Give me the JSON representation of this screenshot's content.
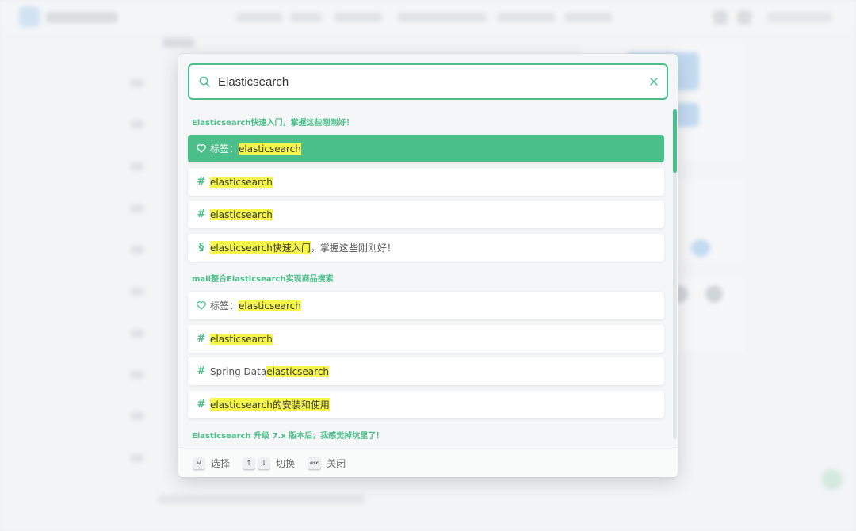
{
  "search": {
    "value": "Elasticsearch"
  },
  "groups": [
    {
      "title": "Elasticsearch快速入门，掌握这些刚刚好！",
      "hits": [
        {
          "icon": "heart-icon",
          "prefix": "标签：",
          "match": "elasticsearch",
          "suffix": "",
          "active": true
        },
        {
          "icon": "hash-icon",
          "prefix": "",
          "match": "elasticsearch",
          "suffix": "",
          "active": false
        },
        {
          "icon": "hash-icon",
          "prefix": "",
          "match": "elasticsearch",
          "suffix": "",
          "active": false
        },
        {
          "icon": "section-icon",
          "prefix": "",
          "match": "elasticsearch快速入门",
          "suffix": "，掌握这些刚刚好！",
          "active": false
        }
      ]
    },
    {
      "title": "mall整合Elasticsearch实现商品搜索",
      "hits": [
        {
          "icon": "heart-icon",
          "prefix": "标签：",
          "match": "elasticsearch",
          "suffix": "",
          "active": false
        },
        {
          "icon": "hash-icon",
          "prefix": "",
          "match": "elasticsearch",
          "suffix": "",
          "active": false
        },
        {
          "icon": "hash-icon",
          "prefix": "Spring Data ",
          "match": "elasticsearch",
          "suffix": "",
          "active": false
        },
        {
          "icon": "hash-icon",
          "prefix": "",
          "match": "elasticsearch的安装和使用",
          "suffix": "",
          "active": false
        }
      ]
    },
    {
      "title": "Elasticsearch 升级 7.x 版本后，我感觉掉坑里了！",
      "hits": []
    }
  ],
  "footer": {
    "select_key": "↵",
    "select_label": "选择",
    "up_key": "↑",
    "down_key": "↓",
    "switch_label": "切换",
    "esc_key": "esc",
    "close_label": "关闭"
  },
  "colors": {
    "accent": "#4bbf8a",
    "highlight": "#f6f64a"
  }
}
